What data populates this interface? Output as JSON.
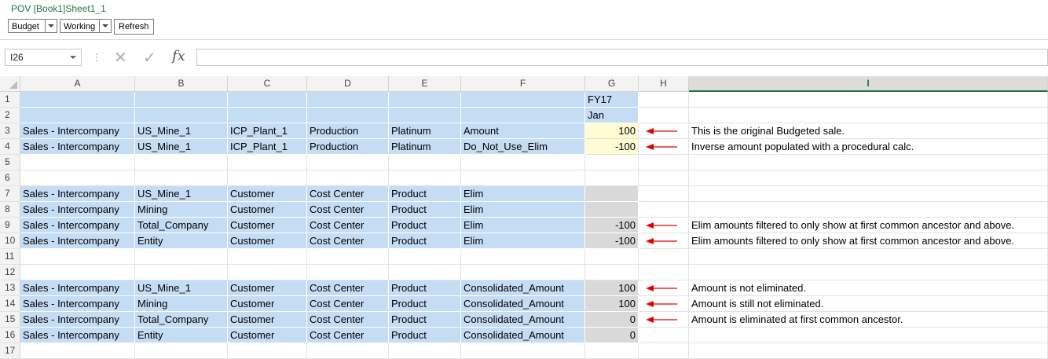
{
  "pov": {
    "title": "POV [Book1]Sheet1_1",
    "scenario": "Budget",
    "version": "Working",
    "refresh_label": "Refresh"
  },
  "formula_bar": {
    "name_box": "I26",
    "cancel_icon": "✕",
    "enter_icon": "✓",
    "fx_label": "fx",
    "formula": ""
  },
  "colors": {
    "accent": "#217346",
    "member_fill": "#c5dcf5",
    "input_fill": "#fffbd3",
    "readonly_fill": "#d9d9d9",
    "arrow": "#e00000"
  },
  "columns": [
    "A",
    "B",
    "C",
    "D",
    "E",
    "F",
    "G",
    "H",
    "I"
  ],
  "selected_column": "I",
  "rows": [
    {
      "n": "1",
      "a": "",
      "b": "",
      "c": "",
      "d": "",
      "e": "",
      "f": "",
      "g": "FY17",
      "note": ""
    },
    {
      "n": "2",
      "a": "",
      "b": "",
      "c": "",
      "d": "",
      "e": "",
      "f": "",
      "g": "Jan",
      "note": ""
    },
    {
      "n": "3",
      "a": "Sales - Intercompany",
      "b": "US_Mine_1",
      "c": "ICP_Plant_1",
      "d": "Production",
      "e": "Platinum",
      "f": "Amount",
      "g": "100",
      "note": "This is the original Budgeted sale."
    },
    {
      "n": "4",
      "a": "Sales - Intercompany",
      "b": "US_Mine_1",
      "c": "ICP_Plant_1",
      "d": "Production",
      "e": "Platinum",
      "f": "Do_Not_Use_Elim",
      "g": "-100",
      "note": "Inverse amount populated with a procedural calc."
    },
    {
      "n": "5",
      "a": "",
      "b": "",
      "c": "",
      "d": "",
      "e": "",
      "f": "",
      "g": "",
      "note": ""
    },
    {
      "n": "6",
      "a": "",
      "b": "",
      "c": "",
      "d": "",
      "e": "",
      "f": "",
      "g": "",
      "note": ""
    },
    {
      "n": "7",
      "a": "Sales - Intercompany",
      "b": "US_Mine_1",
      "c": "Customer",
      "d": "Cost Center",
      "e": "Product",
      "f": "Elim",
      "g": "",
      "note": ""
    },
    {
      "n": "8",
      "a": "Sales - Intercompany",
      "b": "Mining",
      "c": "Customer",
      "d": "Cost Center",
      "e": "Product",
      "f": "Elim",
      "g": "",
      "note": ""
    },
    {
      "n": "9",
      "a": "Sales - Intercompany",
      "b": "Total_Company",
      "c": "Customer",
      "d": "Cost Center",
      "e": "Product",
      "f": "Elim",
      "g": "-100",
      "note": "Elim amounts filtered to only show at first common ancestor and above."
    },
    {
      "n": "10",
      "a": "Sales - Intercompany",
      "b": "Entity",
      "c": "Customer",
      "d": "Cost Center",
      "e": "Product",
      "f": "Elim",
      "g": "-100",
      "note": "Elim amounts filtered to only show at first common ancestor and above."
    },
    {
      "n": "11",
      "a": "",
      "b": "",
      "c": "",
      "d": "",
      "e": "",
      "f": "",
      "g": "",
      "note": ""
    },
    {
      "n": "12",
      "a": "",
      "b": "",
      "c": "",
      "d": "",
      "e": "",
      "f": "",
      "g": "",
      "note": ""
    },
    {
      "n": "13",
      "a": "Sales - Intercompany",
      "b": "US_Mine_1",
      "c": "Customer",
      "d": "Cost Center",
      "e": "Product",
      "f": "Consolidated_Amount",
      "g": "100",
      "note": "Amount is not eliminated."
    },
    {
      "n": "14",
      "a": "Sales - Intercompany",
      "b": "Mining",
      "c": "Customer",
      "d": "Cost Center",
      "e": "Product",
      "f": "Consolidated_Amount",
      "g": "100",
      "note": "Amount is still not eliminated."
    },
    {
      "n": "15",
      "a": "Sales - Intercompany",
      "b": "Total_Company",
      "c": "Customer",
      "d": "Cost Center",
      "e": "Product",
      "f": "Consolidated_Amount",
      "g": "0",
      "note": "Amount is eliminated at first common ancestor."
    },
    {
      "n": "16",
      "a": "Sales - Intercompany",
      "b": "Entity",
      "c": "Customer",
      "d": "Cost Center",
      "e": "Product",
      "f": "Consolidated_Amount",
      "g": "0",
      "note": ""
    },
    {
      "n": "17",
      "a": "",
      "b": "",
      "c": "",
      "d": "",
      "e": "",
      "f": "",
      "g": "",
      "note": ""
    }
  ]
}
